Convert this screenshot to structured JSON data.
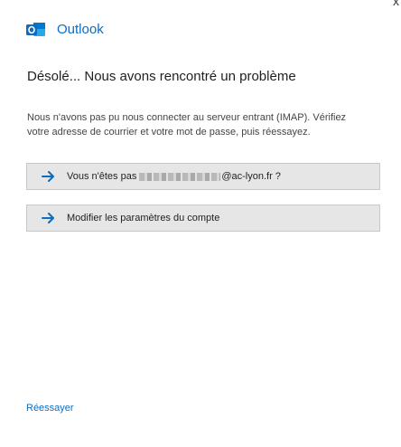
{
  "app": {
    "title": "Outlook",
    "close_glyph": "x",
    "logo_icon": "outlook-logo-icon",
    "brand_color": "#0f6cbd"
  },
  "dialog": {
    "heading": "Désolé... Nous avons rencontré un problème",
    "message": "Nous n'avons pas pu nous connecter au serveur entrant (IMAP). Vérifiez votre adresse de courrier et votre mot de passe, puis réessayez."
  },
  "actions": {
    "not_you": {
      "prefix": "Vous n'êtes pas",
      "suffix": "@ac-lyon.fr ?",
      "icon": "arrow-right-icon"
    },
    "modify_settings": {
      "label": "Modifier les paramètres du compte",
      "icon": "arrow-right-icon"
    }
  },
  "footer": {
    "retry_label": "Réessayer"
  }
}
